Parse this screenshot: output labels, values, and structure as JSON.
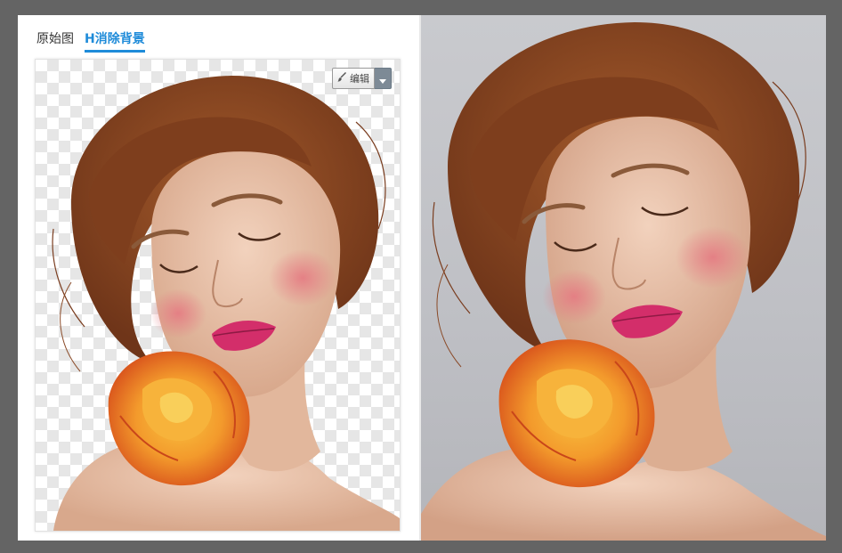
{
  "tabs": {
    "original_label": "原始图",
    "remove_bg_label": "H消除背景"
  },
  "toolbar": {
    "edit_label": "编辑"
  },
  "images": {
    "left": {
      "background": "transparent-checkerboard"
    },
    "right": {
      "background": "gray-studio"
    }
  },
  "colors": {
    "accent": "#1e8bd9",
    "frame": "#646464",
    "hair": "#8b4a25",
    "skin": "#e9c2a8",
    "blush": "#e88a8e",
    "lips": "#d9346f",
    "rose": "#f0872a",
    "rose_center": "#f7b63a"
  },
  "icons": {
    "edit": "brush-icon",
    "dropdown": "caret-down-icon"
  }
}
